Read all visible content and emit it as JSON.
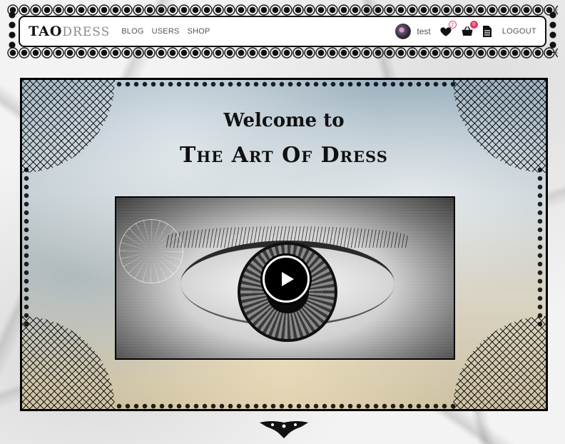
{
  "nav": {
    "logo_prefix": "TAO",
    "logo_suffix": "DRESS",
    "links": [
      "BLOG",
      "USERS",
      "SHOP"
    ],
    "username": "test",
    "wishlist_count": "2",
    "cart_count": "0",
    "logout_label": "LOGOUT"
  },
  "hero": {
    "welcome": "Welcome to",
    "brand": "The Art Of Dress"
  },
  "icons": {
    "wishlist": "heart-icon",
    "cart": "basket-icon",
    "orders": "document-icon",
    "video": "play-icon"
  },
  "colors": {
    "badge": "#e03b63",
    "frame": "#000000"
  }
}
